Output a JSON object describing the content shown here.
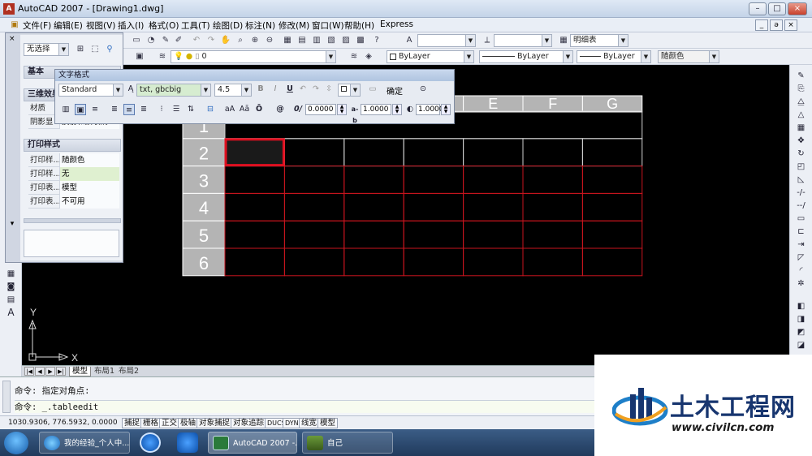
{
  "window": {
    "title": "AutoCAD 2007 - [Drawing1.dwg]",
    "app_icon_glyph": "A",
    "controls": [
      "–",
      "□",
      "×"
    ],
    "mdi_controls": [
      "_",
      "ǝ",
      "×"
    ]
  },
  "menu": {
    "items": [
      "文件(F)",
      "编辑(E)",
      "视图(V)",
      "插入(I)",
      "格式(O)",
      "工具(T)",
      "绘图(D)",
      "标注(N)",
      "修改(M)",
      "窗口(W)",
      "帮助(H)",
      "Express"
    ]
  },
  "toolbar": {
    "layer_value": "0",
    "style_combo": "明细表",
    "color_combo": "ByLayer",
    "linetype_combo": "ByLayer",
    "lineweight_combo": "ByLayer",
    "plotstyle_combo": "随颜色"
  },
  "palette": {
    "selection": "无选择",
    "sections": [
      {
        "title": "基本"
      },
      {
        "title": "三维效果"
      },
      {
        "title": "打印样式"
      }
    ],
    "rows_3d": [
      {
        "key": "材质",
        "value": ""
      },
      {
        "key": "阴影显",
        "value": "投射和接收阴"
      }
    ],
    "rows_plot": [
      {
        "key": "打印样...",
        "value": "随颜色"
      },
      {
        "key": "打印样...",
        "value": "无"
      },
      {
        "key": "打印表...",
        "value": "模型"
      },
      {
        "key": "打印表...",
        "value": "不可用"
      }
    ]
  },
  "text_format": {
    "title": "文字格式",
    "style": "Standard",
    "font": "txt, gbcbig",
    "height": "4.5",
    "ok_label": "确定",
    "oblique": "0.0000",
    "tracking": "1.0000",
    "width_factor": "1.0000",
    "bold": "B",
    "italic": "I",
    "underline": "U",
    "overline": "Ō",
    "symbol": "@",
    "oblique_glyph": "0/",
    "tracking_glyph": "a-b",
    "width_glyph": "◐",
    "uppercase_glyph": "aA",
    "lowercase_glyph": "Aā"
  },
  "table": {
    "columns": [
      "",
      "",
      "",
      "",
      "E",
      "F",
      "G"
    ],
    "rows": [
      "1",
      "2",
      "3",
      "4",
      "5",
      "6"
    ]
  },
  "ucs": {
    "x": "X",
    "y": "Y"
  },
  "layout_tabs": [
    "模型",
    "布局1",
    "布局2"
  ],
  "command": {
    "line1": "命令: 指定对角点:",
    "line2": "命令: _.tableedit"
  },
  "status": {
    "coords": "1030.9306, 776.5932, 0.0000",
    "buttons": [
      "捕捉",
      "栅格",
      "正交",
      "极轴",
      "对象捕捉",
      "对象追踪",
      "DUCS",
      "DYN",
      "线宽",
      "模型"
    ]
  },
  "taskbar": {
    "items": [
      "我的经验_个人中...",
      "AutoCAD 2007 -...",
      "自己"
    ]
  },
  "watermark": {
    "title": "土木工程网",
    "url": "www.civilcn.com"
  },
  "colors": {
    "canvas": "#000000",
    "grid_red": "#c8141e",
    "grid_white": "#d0d0d0",
    "header_gray": "#b4b4b4",
    "selected_cell": "#e01020",
    "brand_blue": "#17356f"
  }
}
